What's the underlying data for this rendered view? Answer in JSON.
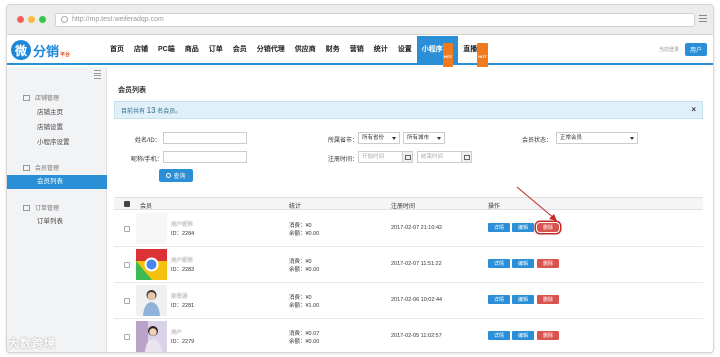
{
  "browser": {
    "url": "http://mp.test.weiferadqp.com"
  },
  "logo": {
    "mark": "微",
    "name": "分销",
    "sub": "平台"
  },
  "nav": {
    "items": [
      "首页",
      "店铺",
      "PC端",
      "商品",
      "订单",
      "会员",
      "分销代理",
      "供应商",
      "财务",
      "营销",
      "统计",
      "设置",
      "小程序",
      "直播"
    ],
    "active": "小程序",
    "hot_badge": "HOT",
    "user_text": "当前登录",
    "user_button": "用户"
  },
  "sidebar": {
    "sections": [
      {
        "title": "店铺管理",
        "items": [
          "店铺主页",
          "店铺设置",
          "小程序设置"
        ]
      },
      {
        "title": "会员管理",
        "items": [
          "会员列表"
        ]
      },
      {
        "title": "订单管理",
        "items": [
          "订单列表"
        ]
      }
    ],
    "active_item": "会员列表"
  },
  "page": {
    "title": "会员列表",
    "info_prefix": "目前共有",
    "info_count": "13",
    "info_suffix": "名会员。",
    "close": "×"
  },
  "filters": {
    "name_label": "姓名/ID：",
    "phone_label": "昵称/手机：",
    "region_label": "所属省市：",
    "province": "所有省份",
    "city": "所有城市",
    "regtime_label": "注册时间：",
    "start_placeholder": "开始时间",
    "end_placeholder": "结束时间",
    "status_label": "会员状态：",
    "status": "正常会员",
    "query_button": "查询"
  },
  "table": {
    "headers": {
      "member": "会员",
      "stats": "统计",
      "regtime": "注册时间",
      "ops": "操作"
    },
    "actions": {
      "detail": "详情",
      "edit": "编辑",
      "delete": "删除"
    },
    "rows": [
      {
        "name": "用户昵称",
        "id": "ID：2284",
        "consume": "消费：¥0",
        "balance": "余额：¥0.00",
        "time": "2017-02-07 21:10:42",
        "avatar": "white"
      },
      {
        "name": "用户昵称",
        "id": "ID：2283",
        "consume": "消费：¥0",
        "balance": "余额：¥0.00",
        "time": "2017-02-07 11:51:22",
        "avatar": "chrome"
      },
      {
        "name": "郭思源",
        "id": "ID：2281",
        "consume": "消费：¥0",
        "balance": "余额：¥1.00",
        "time": "2017-02-06 10:02:44",
        "avatar": "person"
      },
      {
        "name": "用户",
        "id": "ID：2279",
        "consume": "消费：¥0.07",
        "balance": "余额：¥0.00",
        "time": "2017-02-05 11:02:57",
        "avatar": "photo"
      }
    ]
  },
  "watermark": "大数跨境"
}
